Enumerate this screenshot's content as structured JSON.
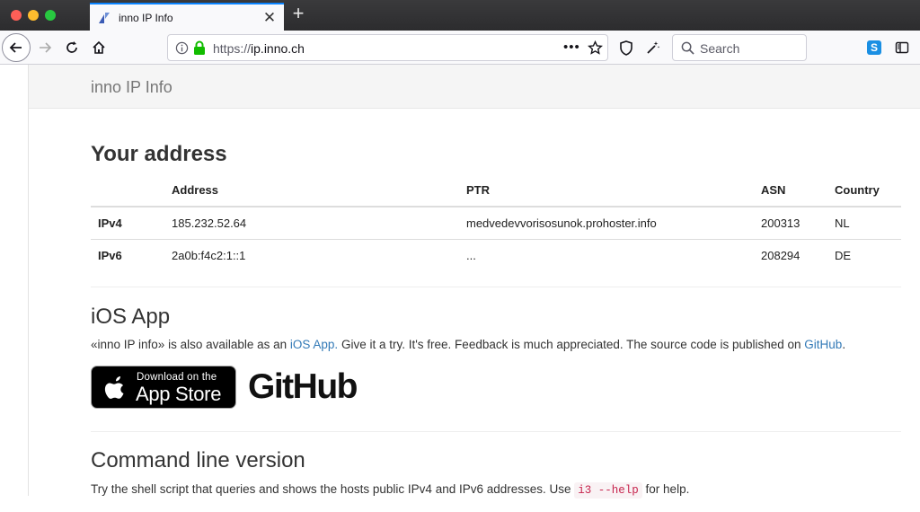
{
  "browser": {
    "tab_title": "inno IP Info",
    "new_tab_label": "+",
    "url_scheme": "https://",
    "url_host": "ip.inno.ch",
    "search_placeholder": "Search",
    "accent_color": "#0a84ff"
  },
  "site": {
    "brand": "inno IP Info"
  },
  "address_section": {
    "heading": "Your address",
    "columns": [
      "Address",
      "PTR",
      "ASN",
      "Country"
    ],
    "rows": [
      {
        "label": "IPv4",
        "address": "185.232.52.64",
        "ptr": "medvedevvorisosunok.prohoster.info",
        "asn": "200313",
        "country": "NL"
      },
      {
        "label": "IPv6",
        "address": "2a0b:f4c2:1::1",
        "ptr": "...",
        "asn": "208294",
        "country": "DE"
      }
    ]
  },
  "ios_section": {
    "heading": "iOS App",
    "text_1": "«inno IP info» is also available as an ",
    "link_ios": "iOS App.",
    "text_2": " Give it a try. It's free. Feedback is much appreciated. The source code is published on ",
    "link_github": "GitHub",
    "text_3": ".",
    "appstore_small": "Download on the",
    "appstore_big": "App Store",
    "github_logo_text": "GitHub"
  },
  "cli_section": {
    "heading": "Command line version",
    "text_1": "Try the shell script that queries and shows the hosts public IPv4 and IPv6 addresses. Use ",
    "code": "i3 --help",
    "text_2": " for help."
  }
}
